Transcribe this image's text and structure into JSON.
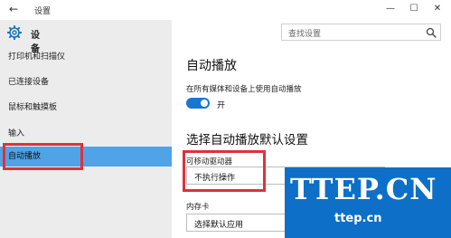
{
  "window": {
    "title": "设置",
    "back_glyph": "←",
    "minimize_glyph": "—",
    "maximize_glyph": "☐",
    "close_glyph": "✕"
  },
  "sidebar": {
    "title": "设备",
    "items": [
      {
        "label": "打印机和扫描仪"
      },
      {
        "label": "已连接设备"
      },
      {
        "label": "鼠标和触摸板"
      },
      {
        "label": "输入"
      },
      {
        "label": "自动播放",
        "active": true
      }
    ]
  },
  "search": {
    "placeholder": "查找设置"
  },
  "autoplay": {
    "heading": "自动播放",
    "toggle_caption": "在所有媒体和设备上使用自动播放",
    "toggle_on": true,
    "toggle_state_label": "开"
  },
  "defaults": {
    "heading": "选择自动播放默认设置",
    "removable_drive": {
      "label": "可移动驱动器",
      "value": "不执行操作"
    },
    "memory_card": {
      "label": "内存卡",
      "value": "选择默认应用"
    }
  },
  "watermark": {
    "line1": "TTEP.CN",
    "line2": "ttep.cn"
  },
  "colors": {
    "accent": "#1975d2",
    "selected_nav": "#4fa3e6",
    "highlight": "#e0303a",
    "watermark_bg": "#0d6fc7"
  }
}
